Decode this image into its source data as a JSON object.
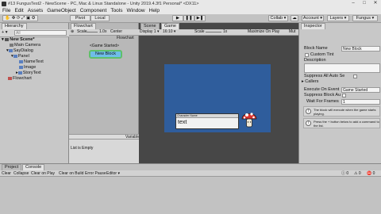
{
  "window": {
    "title": "#13 FungusTest2 - NewScene - PC, Mac & Linux Standalone - Unity 2019.4.3f1 Personal* <DX11>"
  },
  "menu": [
    "File",
    "Edit",
    "Assets",
    "GameObject",
    "Component",
    "Tools",
    "Window",
    "Help"
  ],
  "toolbar": {
    "pivot": "Pivot",
    "local": "Local",
    "collab": "Collab ▾",
    "account": "Account ▾",
    "layers": "Layers ▾",
    "layout": "Fungus ▾"
  },
  "hierarchy": {
    "tab": "Hierarchy",
    "create": "+ ▾",
    "search_placeholder": "All",
    "scene": "New Scene*",
    "items": [
      {
        "label": "Main Camera"
      },
      {
        "label": "SayDialog"
      },
      {
        "label": "Panel"
      },
      {
        "label": "NameText"
      },
      {
        "label": "Image"
      },
      {
        "label": "StoryText"
      },
      {
        "label": "Flowchart"
      }
    ]
  },
  "flowchart_panel": {
    "tab": "Flowchart",
    "scale_label": "Scale",
    "zoom": "1.0x",
    "center_label": "Center",
    "panel_title": "Flowchart",
    "block_event": "<Game Started>",
    "block_name": "New Block",
    "variables_label": "Variables",
    "list_empty": "List is Empty"
  },
  "scene_panel": {
    "tabs": [
      "Scene",
      "Game"
    ],
    "display": "Display 1 ▾",
    "aspect": "16:10 ▾",
    "scale_label": "Scale",
    "scale_value": "1x",
    "maximize": "Maximize On Play",
    "mute": "Mut",
    "game_bg_color": "#2f5d9c",
    "dialog_title": "Character Name",
    "dialog_text": "text"
  },
  "inspector": {
    "tab": "Inspector",
    "block_name_label": "Block Name",
    "block_name_value": "New Block",
    "custom_tint": "Custom Tint",
    "description": "Description",
    "suppress_auto": "Suppress All Auto Se",
    "callers": "Callers",
    "execute_label": "Execute On Event",
    "execute_value": "Game Started",
    "suppress_block": "Suppress Block Au",
    "wait_label": "Wait For Frames",
    "wait_value": "1",
    "info1": "The block will execute when the game starts playing.",
    "info2": "Press the + button below to add a command to the list."
  },
  "console": {
    "tabs": [
      "Project",
      "Console"
    ],
    "buttons": [
      "Clear",
      "Collapse",
      "Clear on Play",
      "Clear on Build",
      "Error Pause",
      "Editor ▾"
    ],
    "counts": [
      "0",
      "0",
      "0"
    ]
  }
}
